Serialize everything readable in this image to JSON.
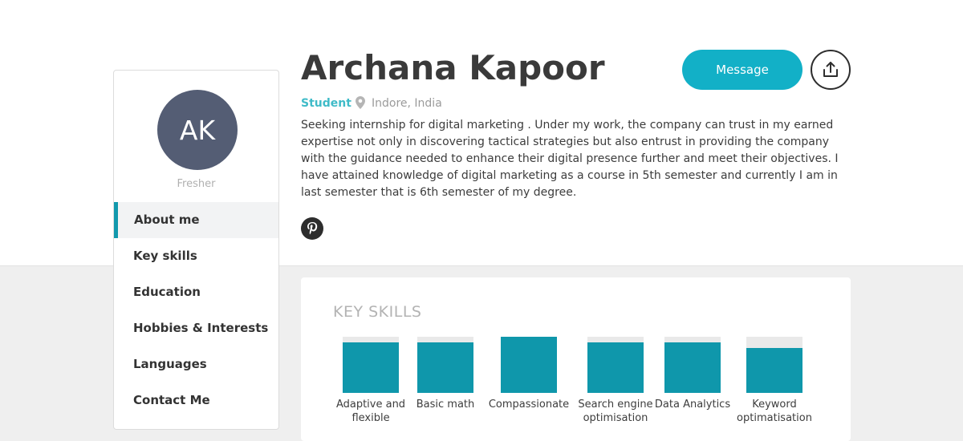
{
  "profile": {
    "initials": "AK",
    "status": "Fresher",
    "name": "Archana Kapoor",
    "role": "Student",
    "location": "Indore, India",
    "about": "Seeking internship for digital marketing . Under my work, the company can trust in my earned expertise not only in discovering tactical strategies but also entrust in providing the company with the guidance needed to enhance their digital presence further and meet their objectives. I have attained knowledge of digital marketing as a course in 5th semester and currently I am in last semester that is 6th semester of my degree."
  },
  "actions": {
    "message_label": "Message",
    "share_icon": "share-icon"
  },
  "social": {
    "pinterest_icon": "pinterest-icon"
  },
  "sidebar": {
    "items": [
      {
        "label": "About me",
        "active": true
      },
      {
        "label": "Key skills",
        "active": false
      },
      {
        "label": "Education",
        "active": false
      },
      {
        "label": "Hobbies & Interests",
        "active": false
      },
      {
        "label": "Languages",
        "active": false
      },
      {
        "label": "Contact Me",
        "active": false
      }
    ]
  },
  "skills": {
    "title": "KEY SKILLS",
    "items": [
      {
        "label": "Adaptive and flexible",
        "level": 0.9
      },
      {
        "label": "Basic math",
        "level": 0.9
      },
      {
        "label": "Compassionate",
        "level": 1.0
      },
      {
        "label": "Search engine optimisation",
        "level": 0.9
      },
      {
        "label": "Data Analytics",
        "level": 0.9
      },
      {
        "label": "Keyword optimatisation",
        "level": 0.8
      }
    ]
  },
  "colors": {
    "accent": "#12b0c7",
    "skill_fill": "#0f97ab",
    "avatar_bg": "#545d74"
  }
}
